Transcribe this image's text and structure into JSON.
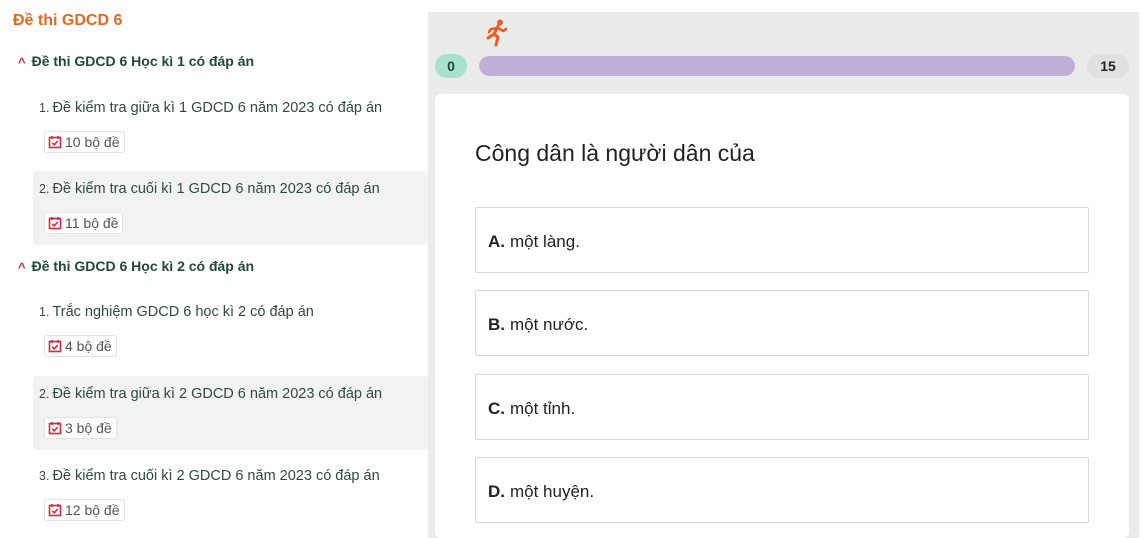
{
  "sidebar": {
    "title": "Đề thi GDCD 6",
    "sections": [
      {
        "title": "Đề thi GDCD 6 Học kì 1 có đáp án",
        "items": [
          {
            "num": "1.",
            "label": "Đề kiểm tra giữa kì 1 GDCD 6 năm 2023 có đáp án",
            "count": "10 bộ đề"
          },
          {
            "num": "2.",
            "label": "Đề kiểm tra cuối kì 1 GDCD 6 năm 2023 có đáp án",
            "count": "11 bộ đề"
          }
        ]
      },
      {
        "title": "Đề thi GDCD 6 Học kì 2 có đáp án",
        "items": [
          {
            "num": "1.",
            "label": "Trắc nghiệm GDCD 6 học kì 2 có đáp án",
            "count": "4 bộ đề"
          },
          {
            "num": "2.",
            "label": "Đề kiểm tra giữa kì 2 GDCD 6 năm 2023 có đáp án",
            "count": "3 bộ đề"
          },
          {
            "num": "3.",
            "label": "Đề kiểm tra cuối kì 2 GDCD 6 năm 2023 có đáp án",
            "count": "12 bộ đề"
          }
        ]
      }
    ]
  },
  "progress": {
    "start": "0",
    "end": "15",
    "fill_fraction": 1.0,
    "runner_icon": "running-person-icon"
  },
  "quiz": {
    "question": "Công dân là người dân của",
    "options": [
      {
        "letter": "A.",
        "text": "một làng."
      },
      {
        "letter": "B.",
        "text": "một nước."
      },
      {
        "letter": "C.",
        "text": "một tỉnh."
      },
      {
        "letter": "D.",
        "text": "một huyện."
      }
    ]
  },
  "colors": {
    "title_orange": "#e8661f",
    "chevron_red": "#d6283a",
    "badge_icon_red": "#d6283a",
    "progress_fill": "#c0b0d8",
    "start_pill": "#a8e2cf"
  }
}
